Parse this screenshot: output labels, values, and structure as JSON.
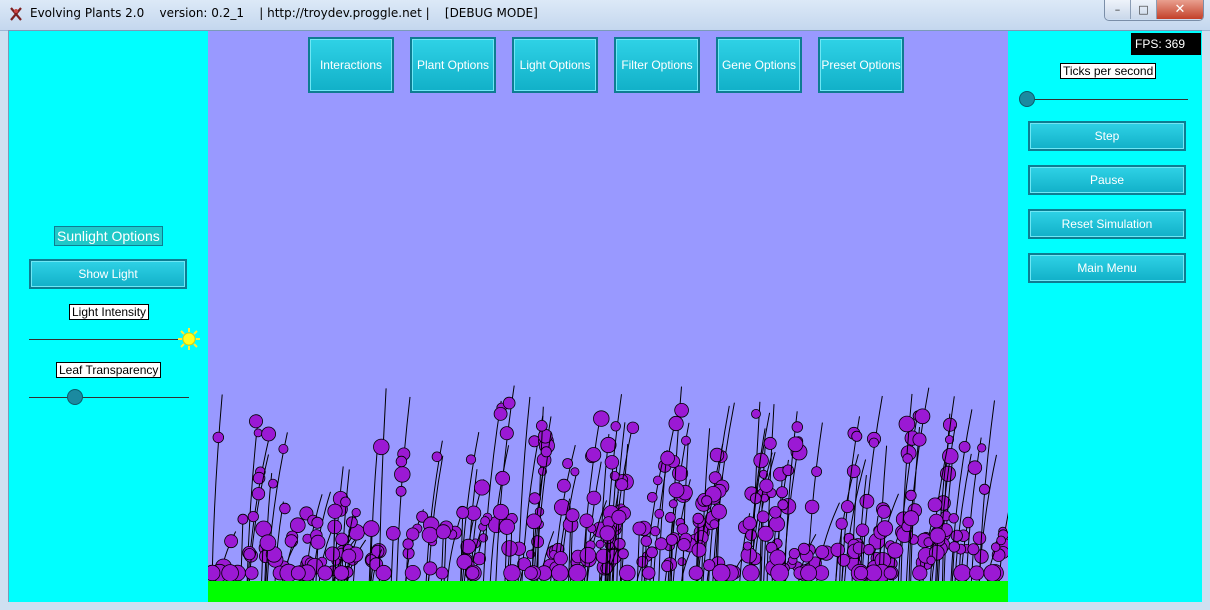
{
  "window": {
    "title": "Evolving Plants 2.0    version: 0.2_1    | http://troydev.proggle.net |    [DEBUG MODE]",
    "minimize": "–",
    "maximize": "□",
    "close": "✕"
  },
  "top_menu": [
    {
      "label": "Interactions"
    },
    {
      "label": "Plant Options"
    },
    {
      "label": "Light Options"
    },
    {
      "label": "Filter Options"
    },
    {
      "label": "Gene Options"
    },
    {
      "label": "Preset Options"
    }
  ],
  "left_panel": {
    "section_title": "Sunlight Options",
    "show_light": "Show Light",
    "light_intensity_label": "Light Intensity",
    "light_intensity_value": 1.0,
    "leaf_transparency_label": "Leaf Transparency",
    "leaf_transparency_value": 0.3
  },
  "right_panel": {
    "fps": "FPS: 369",
    "ticks_label": "Ticks per second",
    "ticks_value": 0.0,
    "step": "Step",
    "pause": "Pause",
    "reset": "Reset Simulation",
    "main_menu": "Main Menu"
  },
  "colors": {
    "cyan_panel": "#00ffff",
    "sky": "#9999ff",
    "ground": "#00ff00",
    "leaf": "#9b19d4",
    "stem": "#000000",
    "button": "#19bfd6"
  },
  "icons": [
    "app-icon",
    "sun-icon"
  ]
}
